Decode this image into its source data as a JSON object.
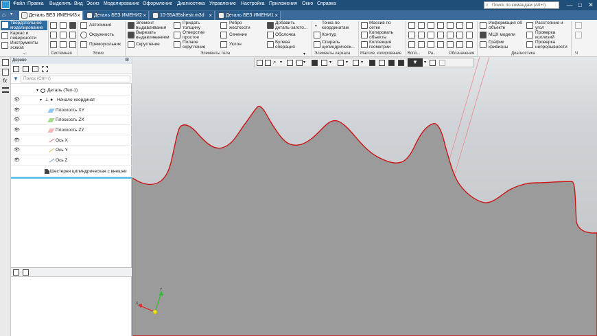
{
  "title_bar": {
    "menu": [
      "Файл",
      "Правка",
      "Выделить",
      "Вид",
      "Эскиз",
      "Моделирование",
      "Оформление",
      "Диагностика",
      "Управление",
      "Настройка",
      "Приложения",
      "Окно",
      "Справка"
    ],
    "search_placeholder": "Поиск по командам (Alt+/)",
    "window_buttons": [
      "—",
      "□",
      "✕"
    ]
  },
  "tabs": [
    {
      "label": "Деталь БЕЗ ИМЕНИ3",
      "active": true,
      "close": "×"
    },
    {
      "label": "Деталь БЕЗ ИМЕНИ2",
      "active": false,
      "close": "×"
    },
    {
      "label": "10-55A85shestr.m3d",
      "active": false,
      "close": "×"
    },
    {
      "label": "Деталь БЕЗ ИМЕНИ1",
      "active": false,
      "close": "×"
    }
  ],
  "ribbon": {
    "modes": [
      "Твердотельное моделирование",
      "Каркас и поверхности",
      "Инструменты эскиза"
    ],
    "system_group": "Системная",
    "sketch_items": [
      "Автолиния",
      "Окружность",
      "Прямоугольник"
    ],
    "sketch_group": "Эскиз",
    "body_items": [
      "Элемент выдавливания",
      "Вырезать выдавливанием",
      "Скругление",
      "Придать толщину",
      "Отверстие простое",
      "Полное скругление",
      "Ребро жесткости",
      "Сечение",
      "Уклон",
      "Добавить деталь-загото...",
      "Оболочка",
      "Булева операция"
    ],
    "body_group": "Элементы тела",
    "frame_items": [
      "Точка по координатам",
      "Контур",
      "Спираль цилиндрическ..."
    ],
    "frame_group": "Элементы каркаса",
    "array_items": [
      "Массив по сетке",
      "Копировать объекты",
      "Коллекция геометрии"
    ],
    "array_group": "Массив, копирование",
    "aux_groups": [
      "Вспо...",
      "Ра...",
      "Обозначения"
    ],
    "diag_items": [
      "Информация об объекте",
      "МЦХ модели",
      "График кривизны",
      "Расстояние и угол",
      "Проверка коллизий",
      "Проверка непрерывности"
    ],
    "diag_group": "Диагностика",
    "last_group": "Ч"
  },
  "tree": {
    "header": "Дерево",
    "filter_placeholder": "Поиск (Ctrl+/)",
    "rows": [
      {
        "label": "Деталь (Тел-1)",
        "eye": ""
      },
      {
        "label": "Начало координат",
        "eye": "👁"
      },
      {
        "label": "Плоскость XY",
        "eye": "👁"
      },
      {
        "label": "Плоскость ZX",
        "eye": "👁"
      },
      {
        "label": "Плоскость ZY",
        "eye": "👁"
      },
      {
        "label": "Ось X",
        "eye": "👁"
      },
      {
        "label": "Ось Y",
        "eye": "👁"
      },
      {
        "label": "Ось Z",
        "eye": "👁"
      },
      {
        "label": "Шестерня цилиндрическая с внешни",
        "eye": ""
      }
    ]
  },
  "axes_labels": {
    "y": "Y",
    "x": "X"
  },
  "colors": {
    "titlebar": "#1f4e79",
    "tabbar": "#3b6b9a",
    "accent": "#2d6da3",
    "edge": "#d11a1a",
    "gear_face": "#9b9b9b",
    "axis_line": "#e88a8a"
  }
}
